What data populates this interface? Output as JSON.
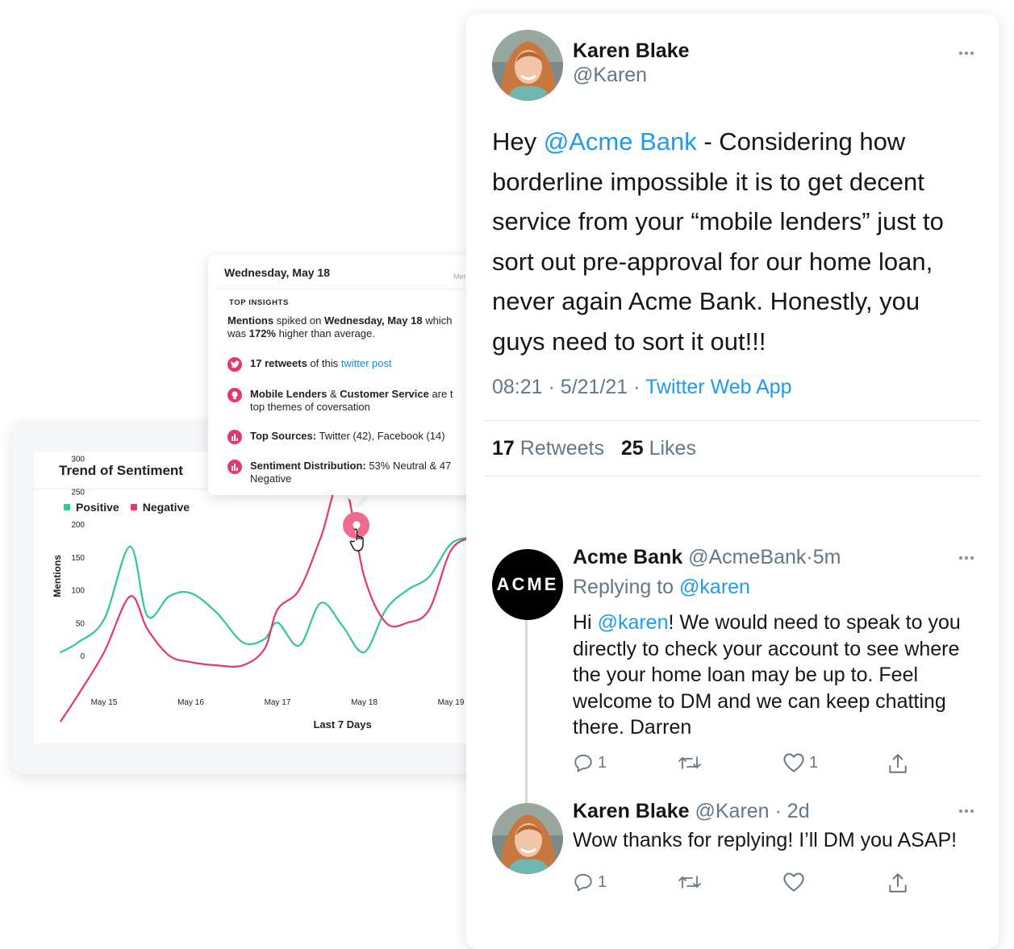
{
  "chart": {
    "title": "Trend of Sentiment",
    "legend": [
      {
        "label": "Positive",
        "color": "#2ec79a"
      },
      {
        "label": "Negative",
        "color": "#e4386c"
      }
    ]
  },
  "chart_data": {
    "type": "line",
    "title": "Trend of Sentiment",
    "xlabel": "Last 7 Days",
    "ylabel": "Mentions",
    "categories": [
      "May 15",
      "May 16",
      "May 17",
      "May 18",
      "May 19"
    ],
    "y_ticks": [
      0,
      50,
      100,
      150,
      200,
      250,
      300
    ],
    "ylim": [
      0,
      300
    ],
    "x": [
      14.5,
      14.7,
      15.0,
      15.3,
      15.5,
      15.75,
      16.0,
      16.3,
      16.6,
      16.85,
      17.0,
      17.25,
      17.5,
      17.75,
      18.0,
      18.25,
      18.5,
      18.75,
      19.0,
      19.25
    ],
    "series": [
      {
        "name": "Positive",
        "color": "#2ec79a",
        "values": [
          5,
          20,
          55,
          166,
          60,
          90,
          95,
          65,
          20,
          25,
          50,
          15,
          80,
          45,
          5,
          70,
          100,
          120,
          170,
          180
        ]
      },
      {
        "name": "Negative",
        "color": "#e4386c",
        "values": [
          -100,
          -60,
          5,
          90,
          40,
          0,
          -10,
          -15,
          -15,
          10,
          70,
          100,
          180,
          270,
          120,
          50,
          50,
          70,
          160,
          180
        ]
      }
    ],
    "highlight": {
      "x": 18.0,
      "label": "May 18"
    },
    "legend_position": "top-left",
    "grid": false
  },
  "tooltip": {
    "date": "Wednesday, May 18",
    "meta": "Men",
    "heading": "TOP INSIGHTS",
    "summary": {
      "bold1": "Mentions",
      "text1": " spiked on ",
      "bold2": "Wednesday, May 18",
      "text2": " which",
      "line2a": "was ",
      "bold3": "172%",
      "line2b": " higher than average."
    },
    "items": [
      {
        "icon": "twitter-icon",
        "bold": "17 retweets",
        "text": " of this ",
        "link": "twitter post",
        "line2": ""
      },
      {
        "icon": "lightbulb-icon",
        "bold": "Mobile Lenders",
        "text": " & ",
        "bold2": "Customer Service",
        "text2": " are t",
        "line2": "top themes of coversation"
      },
      {
        "icon": "bar-chart-icon",
        "bold": "Top Sources:",
        "text": " Twitter (42), Facebook (14)"
      },
      {
        "icon": "bar-chart-icon",
        "bold": "Sentiment Distribution:",
        "text": " 53% Neutral & 47",
        "line2": "Negative"
      }
    ]
  },
  "tweet": {
    "author_name": "Karen Blake",
    "author_handle": "@Karen",
    "body_pre": "Hey ",
    "body_mention": "@Acme Bank",
    "body_post": " - Considering how borderline impossible it is to get decent service from your “mobile lenders” just to sort out pre-approval for our home loan, never again Acme Bank. Honestly, you guys need to sort it out!!!",
    "time": "08:21",
    "date": "5/21/21",
    "separator": "·",
    "source": "Twitter Web App",
    "retweets": "17",
    "retweets_label": "Retweets",
    "likes": "25",
    "likes_label": "Likes"
  },
  "replies": [
    {
      "avatar_text": "ACME",
      "name": "Acme Bank",
      "handle": "@AcmeBank",
      "time": "·5m",
      "replying_to_label": "Replying to",
      "replying_to": "@karen",
      "text_pre": "Hi ",
      "text_mention": "@karen",
      "text_post": "! We would need to speak to you directly to check your account to see where the your home loan may be up to. Feel welcome to DM and we can keep chatting there. Darren",
      "reply_count": "1",
      "like_count": "1"
    },
    {
      "name": "Karen Blake",
      "handle": "@Karen",
      "time": "· 2d",
      "text": "Wow thanks for replying! I’ll DM you ASAP!",
      "reply_count": "1"
    }
  ]
}
